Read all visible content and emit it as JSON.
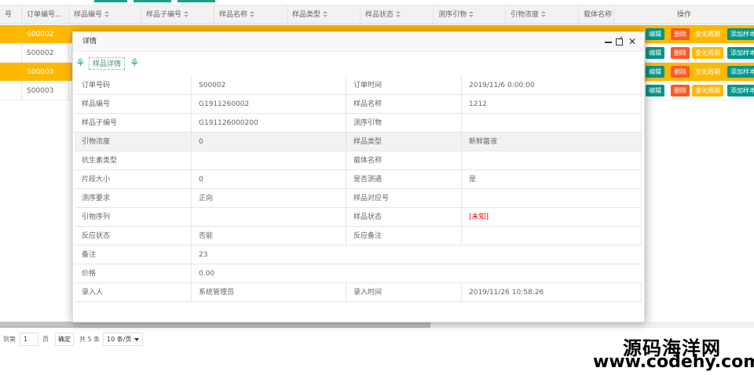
{
  "grid": {
    "headers": [
      "号",
      "订单编号...",
      "样品编号",
      "样品子编号",
      "样品名称",
      "样品类型",
      "样品状态",
      "测序引物",
      "引物浓度",
      "载体名称",
      "操作"
    ],
    "rows": [
      {
        "order_no": "S00002",
        "selected": true
      },
      {
        "order_no": "S00002",
        "selected": false
      },
      {
        "order_no": "S00003",
        "selected": true
      },
      {
        "order_no": "S00003",
        "selected": false
      }
    ],
    "ops": {
      "edit": "编辑",
      "delete": "删除",
      "cycle": "变化周期",
      "add": "添加样本"
    },
    "row_colors": {
      "selected": "#ffb800",
      "edit": "#009688",
      "delete": "#ff5722",
      "cycle": "#ffb800",
      "add": "#009688"
    }
  },
  "pager": {
    "goto_label": "到第",
    "page_value": "1",
    "page_unit": "页",
    "confirm": "确定",
    "total": "共 5 条",
    "page_size": "10 条/页"
  },
  "modal": {
    "title": "详情",
    "tab_label": "样品详情",
    "rows": [
      {
        "k1": "订单号码",
        "v1": "S00002",
        "k2": "订单时间",
        "v2": "2019/11/6 0:00:00"
      },
      {
        "k1": "样品编号",
        "v1": "G1911260002",
        "k2": "样品名称",
        "v2": "1212"
      },
      {
        "k1": "样品子编号",
        "v1": "G191126000200",
        "k2": "测序引物",
        "v2": ""
      },
      {
        "k1": "引物浓度",
        "v1": "0",
        "k2": "样品类型",
        "v2": "新鲜菌液"
      },
      {
        "k1": "抗生素类型",
        "v1": "",
        "k2": "载体名称",
        "v2": ""
      },
      {
        "k1": "片段大小",
        "v1": "0",
        "k2": "是否测通",
        "v2": "是"
      },
      {
        "k1": "测序要求",
        "v1": "正向",
        "k2": "样品对应号",
        "v2": ""
      },
      {
        "k1": "引物序列",
        "v1": "",
        "k2": "样品状态",
        "v2": "[未知]"
      },
      {
        "k1": "反应状态",
        "v1": "否能",
        "k2": "反应备注",
        "v2": ""
      },
      {
        "k1": "备注",
        "v1": "23",
        "k2": "",
        "v2": ""
      },
      {
        "k1": "价格",
        "v1": "0.00",
        "k2": "",
        "v2": ""
      },
      {
        "k1": "录入人",
        "v1": "系统管理员",
        "k2": "录入时间",
        "v2": "2019/11/26 10:58:26"
      }
    ]
  },
  "watermark": {
    "line1": "源码海洋网",
    "line2": "www.codehy.com"
  }
}
